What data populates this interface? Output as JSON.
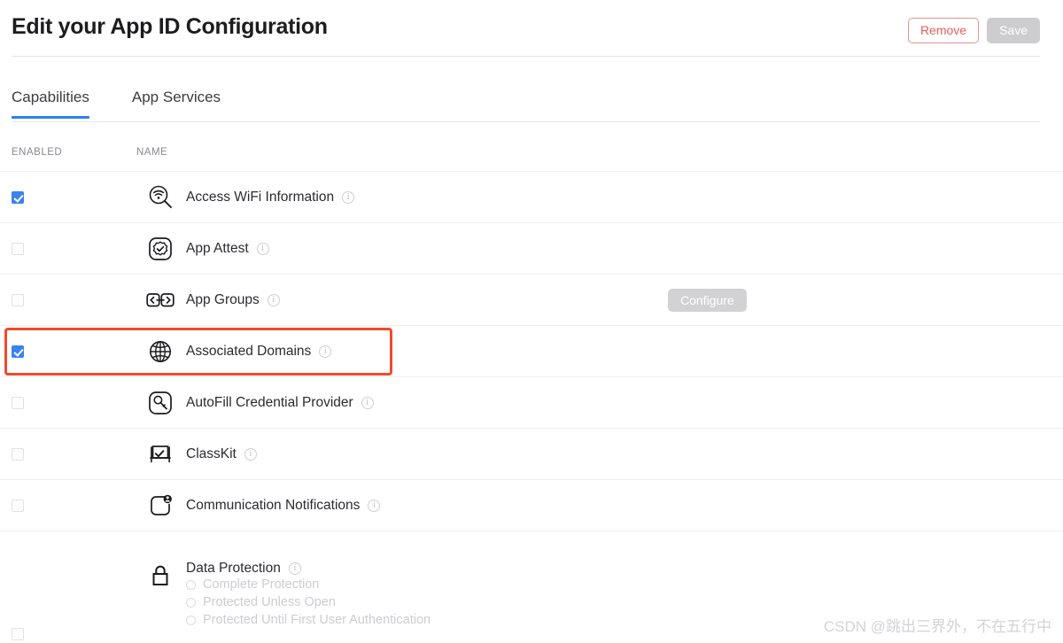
{
  "header": {
    "title": "Edit your App ID Configuration",
    "remove_label": "Remove",
    "save_label": "Save"
  },
  "tabs": [
    {
      "label": "Capabilities",
      "active": true
    },
    {
      "label": "App Services",
      "active": false
    }
  ],
  "table": {
    "columns": {
      "enabled": "ENABLED",
      "name": "NAME"
    },
    "rows": [
      {
        "name": "Access WiFi Information",
        "icon": "wifi-magnifier-icon",
        "checked": true,
        "info": "i",
        "action": null
      },
      {
        "name": "App Attest",
        "icon": "attest-badge-check-icon",
        "checked": false,
        "info": "i",
        "action": null
      },
      {
        "name": "App Groups",
        "icon": "app-groups-arrows-icon",
        "checked": false,
        "info": "i",
        "action": "Configure"
      },
      {
        "name": "Associated Domains",
        "icon": "globe-icon",
        "checked": true,
        "info": "i",
        "action": null,
        "highlighted": true
      },
      {
        "name": "AutoFill Credential Provider",
        "icon": "key-icon",
        "checked": false,
        "info": "i",
        "action": null
      },
      {
        "name": "ClassKit",
        "icon": "chalkboard-check-icon",
        "checked": false,
        "info": "i",
        "action": null
      },
      {
        "name": "Communication Notifications",
        "icon": "notification-person-icon",
        "checked": false,
        "info": "i",
        "action": null
      },
      {
        "name": "Data Protection",
        "icon": "lock-icon",
        "checked": false,
        "info": "i",
        "action": null,
        "options": [
          "Complete Protection",
          "Protected Unless Open",
          "Protected Until First User Authentication"
        ]
      }
    ]
  },
  "watermark": "CSDN @跳出三界外，不在五行中",
  "colors": {
    "accent_blue": "#3b83f0",
    "tab_underline": "#2c7ef0",
    "remove_red": "#e8605c",
    "annotation_red": "#f04a2a",
    "disabled_gray": "#cdcdd0"
  }
}
